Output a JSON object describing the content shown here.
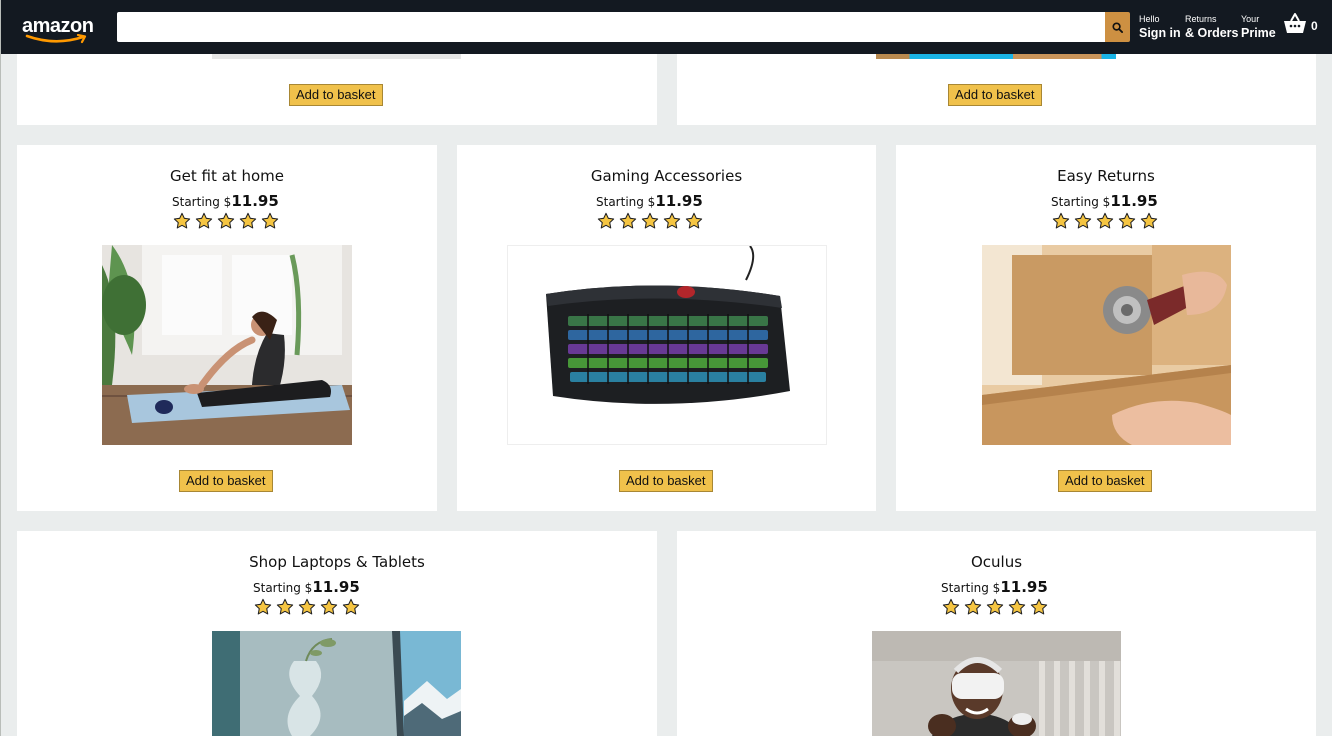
{
  "header": {
    "logo_text": "amazon",
    "search": {
      "value": "",
      "placeholder": ""
    },
    "nav": [
      {
        "line1": "Hello",
        "line2": "Sign in"
      },
      {
        "line1": "Returns",
        "line2": "& Orders"
      },
      {
        "line1": "Your",
        "line2": "Prime"
      }
    ],
    "basket_count": "0"
  },
  "colors": {
    "header_bg": "#131921",
    "search_button": "#cd9042",
    "add_button": "#f0c14b",
    "page_bg": "#eaeded",
    "star": "#f5c542"
  },
  "top_row": [
    {
      "add_label": "Add to basket"
    },
    {
      "add_label": "Add to basket"
    }
  ],
  "products": [
    {
      "title": "Get fit at home",
      "price_prefix": "Starting $",
      "price": "11.95",
      "rating": 5,
      "image": "woman-stretching-on-yoga-mat",
      "add_label": "Add to basket"
    },
    {
      "title": "Gaming Accessories",
      "price_prefix": "Starting $",
      "price": "11.95",
      "rating": 5,
      "image": "rgb-gaming-keyboard",
      "add_label": "Add to basket"
    },
    {
      "title": "Easy Returns",
      "price_prefix": "Starting $",
      "price": "11.95",
      "rating": 5,
      "image": "taping-cardboard-box",
      "add_label": "Add to basket"
    },
    {
      "title": "Shop Laptops & Tablets",
      "price_prefix": "Starting $",
      "price": "11.95",
      "rating": 5,
      "image": "laptop-with-vase"
    },
    {
      "title": "Oculus",
      "price_prefix": "Starting $",
      "price": "11.95",
      "rating": 5,
      "image": "man-wearing-vr-headset"
    }
  ]
}
